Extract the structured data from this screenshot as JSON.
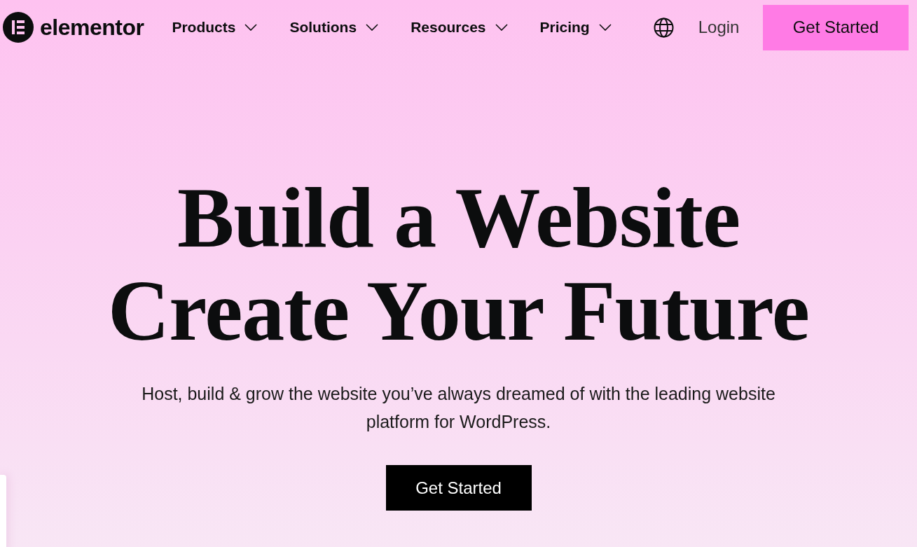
{
  "header": {
    "logo": {
      "text": "elementor"
    },
    "nav_items": [
      {
        "label": "Products"
      },
      {
        "label": "Solutions"
      },
      {
        "label": "Resources"
      },
      {
        "label": "Pricing"
      }
    ],
    "login": "Login",
    "cta": "Get Started"
  },
  "hero": {
    "headline": [
      "Build a Website",
      "Create Your Future"
    ],
    "subtitle": "Host, build & grow the website you’ve always dreamed of with the leading website platform for WordPress.",
    "cta": "Get Started"
  }
}
